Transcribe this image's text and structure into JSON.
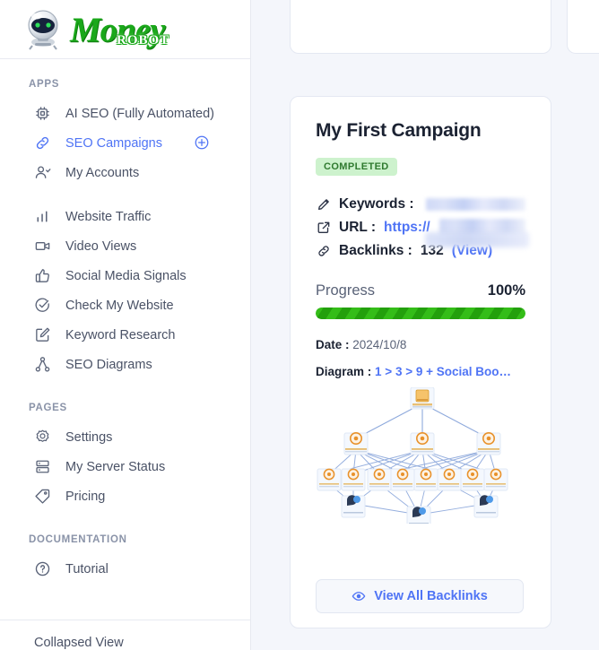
{
  "brand": {
    "name_primary": "Money",
    "name_secondary": "ROBOT",
    "logo_icon": "robot-head-icon"
  },
  "sidebar": {
    "sections": [
      {
        "label": "APPS",
        "items": [
          {
            "label": "AI SEO (Fully Automated)",
            "icon": "chip-icon",
            "active": false
          },
          {
            "label": "SEO Campaigns",
            "icon": "link-chain-icon",
            "active": true,
            "action_icon": "plus-circle-icon"
          },
          {
            "label": "My Accounts",
            "icon": "user-check-icon",
            "active": false
          },
          {
            "label": "Website Traffic",
            "icon": "bar-chart-icon",
            "active": false
          },
          {
            "label": "Video Views",
            "icon": "video-camera-icon",
            "active": false
          },
          {
            "label": "Social Media Signals",
            "icon": "thumbs-up-icon",
            "active": false
          },
          {
            "label": "Check My Website",
            "icon": "check-circle-icon",
            "active": false
          },
          {
            "label": "Keyword Research",
            "icon": "edit-square-icon",
            "active": false
          },
          {
            "label": "SEO Diagrams",
            "icon": "sitemap-icon",
            "active": false
          }
        ]
      },
      {
        "label": "PAGES",
        "items": [
          {
            "label": "Settings",
            "icon": "gear-icon",
            "active": false
          },
          {
            "label": "My Server Status",
            "icon": "server-icon",
            "active": false
          },
          {
            "label": "Pricing",
            "icon": "tag-icon",
            "active": false
          }
        ]
      },
      {
        "label": "DOCUMENTATION",
        "items": [
          {
            "label": "Tutorial",
            "icon": "question-circle-icon",
            "active": false
          }
        ]
      }
    ],
    "footer": {
      "label": "Collapsed View"
    }
  },
  "campaign": {
    "title": "My First Campaign",
    "status": "COMPLETED",
    "keywords_label": "Keywords :",
    "keywords_value": "",
    "url_label": "URL :",
    "url_value": "https://",
    "backlinks_label": "Backlinks :",
    "backlinks_count": "132",
    "backlinks_view": "(View)",
    "progress_label": "Progress",
    "progress_value": "100%",
    "progress_percent": 100,
    "date_label": "Date :",
    "date_value": "2024/10/8",
    "diagram_label": "Diagram :",
    "diagram_value": "1 > 3 > 9 + Social Boo…",
    "view_all_button": "View All Backlinks",
    "icons": {
      "keywords": "pencil-icon",
      "url": "external-link-icon",
      "backlinks": "link-chain-icon",
      "view_all": "eye-icon"
    }
  },
  "colors": {
    "accent_blue": "#4f74f5",
    "brand_green": "#1aa81a",
    "progress_green": "#2bad13",
    "badge_bg": "#cdf2cd",
    "badge_text": "#2f7a2f",
    "page_bg": "#f4f6fb",
    "node_orange": "#e8912a",
    "edge_blue": "#7b9bd6"
  },
  "diagram_preview": {
    "tier1_nodes": 1,
    "tier2_nodes": 3,
    "tier3_nodes": 9,
    "social_nodes": 3,
    "node_icon": "coin-page-icon",
    "social_icon": "social-share-icon"
  }
}
